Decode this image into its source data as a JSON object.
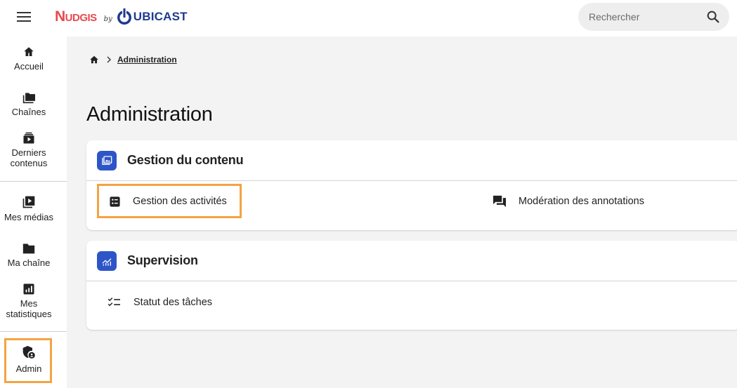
{
  "header": {
    "logo": {
      "brand": "Nudgis",
      "by": "by",
      "company": "UBICAST",
      "brand_color": "#e8494f",
      "company_color": "#1f3a8f"
    },
    "menu_icon": "hamburger-icon",
    "search": {
      "placeholder": "Rechercher",
      "value": "",
      "icon": "search-icon"
    }
  },
  "sidebar": {
    "items": [
      {
        "label": "Accueil",
        "icon": "home-icon"
      },
      {
        "label": "Chaînes",
        "icon": "folders-icon"
      },
      {
        "label": "Derniers contenus",
        "icon": "latest-videos-icon"
      },
      {
        "label": "Mes médias",
        "icon": "my-media-icon"
      },
      {
        "label": "Ma chaîne",
        "icon": "folder-icon"
      },
      {
        "label": "Mes statistiques",
        "icon": "statistics-icon"
      },
      {
        "label": "Admin",
        "icon": "admin-shield-icon",
        "highlighted": true
      }
    ]
  },
  "breadcrumb": {
    "home_icon": "home-icon",
    "current": "Administration"
  },
  "page": {
    "title": "Administration",
    "sections": [
      {
        "title": "Gestion du contenu",
        "icon": "content-management-icon",
        "links": [
          {
            "label": "Gestion des activités",
            "icon": "activities-list-icon",
            "highlighted": true
          },
          {
            "label": "Modération des annotations",
            "icon": "annotations-icon"
          }
        ]
      },
      {
        "title": "Supervision",
        "icon": "supervision-chart-icon",
        "links": [
          {
            "label": "Statut des tâches",
            "icon": "task-checklist-icon"
          }
        ]
      }
    ]
  },
  "colors": {
    "accent": "#2d55c8",
    "highlight": "#f4a343",
    "main_bg": "#f3f3f3"
  }
}
